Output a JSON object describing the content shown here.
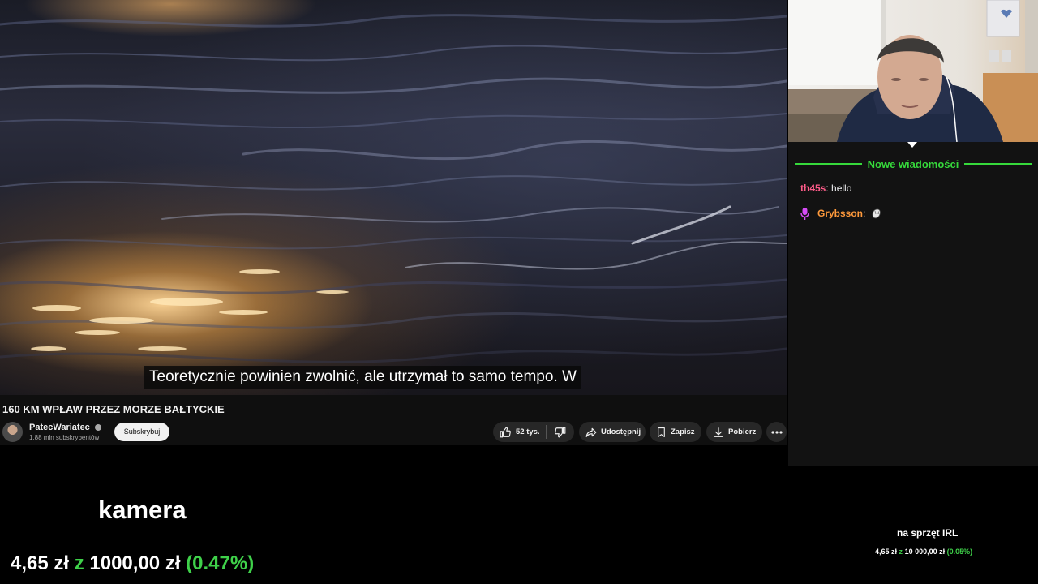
{
  "video": {
    "subtitle": "Teoretycznie powinien zwolnić, ale utrzymał to samo tempo.  W",
    "title": "160 KM WPŁAW PRZEZ MORZE BAŁTYCKIE",
    "channel_name": "PatecWariatec",
    "subscriber_count": "1,88 mln subskrybentów",
    "subscribe_label": "Subskrybuj",
    "like_count": "52 tys.",
    "share_label": "Udostępnij",
    "save_label": "Zapisz",
    "download_label": "Pobierz"
  },
  "chat": {
    "new_messages_label": "Nowe wiadomości",
    "messages": [
      {
        "user": "th45s",
        "text": "hello"
      },
      {
        "user": "Grybsson",
        "text": "",
        "emote": "cartoon-hand-emote"
      }
    ]
  },
  "goals": {
    "main": {
      "label": "kamera",
      "current": "4,65 zł",
      "separator": "z",
      "target": "1000,00 zł",
      "percent": "(0.47%)",
      "progress_fraction": 0.0047
    },
    "secondary": {
      "label": "na sprzęt IRL",
      "current": "4,65 zł",
      "separator": "z",
      "target": "10 000,00 zł",
      "percent": "(0.05%)",
      "progress_fraction": 0.0005
    }
  },
  "colors": {
    "goal_green": "#3fd14a",
    "chat_new_line": "#36d93b",
    "user_th45s": "#ff5c8a",
    "user_grybsson": "#ff9a3c"
  }
}
